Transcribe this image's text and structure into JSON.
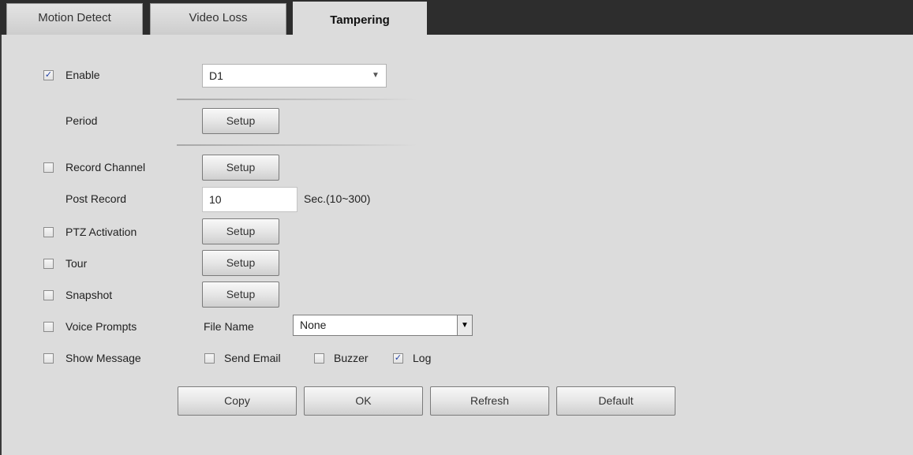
{
  "tabs": [
    {
      "label": "Motion Detect"
    },
    {
      "label": "Video Loss"
    },
    {
      "label": "Tampering",
      "active": true
    }
  ],
  "enable": {
    "label": "Enable",
    "checked": true,
    "select_value": "D1"
  },
  "period": {
    "label": "Period",
    "button": "Setup"
  },
  "record_channel": {
    "label": "Record Channel",
    "checked": false,
    "button": "Setup"
  },
  "post_record": {
    "label": "Post Record",
    "value": "10",
    "hint": "Sec.(10~300)"
  },
  "ptz_activation": {
    "label": "PTZ Activation",
    "checked": false,
    "button": "Setup"
  },
  "tour": {
    "label": "Tour",
    "checked": false,
    "button": "Setup"
  },
  "snapshot": {
    "label": "Snapshot",
    "checked": false,
    "button": "Setup"
  },
  "voice_prompts": {
    "label": "Voice Prompts",
    "checked": false,
    "file_name_label": "File Name",
    "file_name_value": "None"
  },
  "show_message": {
    "label": "Show Message",
    "checked": false
  },
  "send_email": {
    "label": "Send Email",
    "checked": false
  },
  "buzzer": {
    "label": "Buzzer",
    "checked": false
  },
  "log": {
    "label": "Log",
    "checked": true
  },
  "actions": {
    "copy": "Copy",
    "ok": "OK",
    "refresh": "Refresh",
    "default": "Default"
  },
  "colors": {
    "background": "#dcdcdc",
    "tab_bar": "#2d2d2d",
    "check_mark": "#1f3fa5"
  },
  "icons": {
    "check": "✓",
    "dropdown_arrow": "▼"
  }
}
